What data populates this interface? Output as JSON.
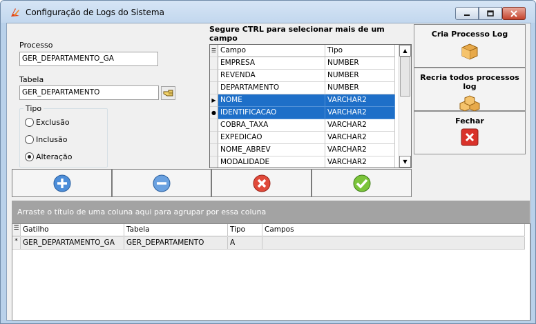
{
  "window": {
    "title": "Configuração de Logs do Sistema",
    "accent": "#1e6fc8"
  },
  "form": {
    "processo_label": "Processo",
    "processo_value": "GER_DEPARTAMENTO_GA",
    "tabela_label": "Tabela",
    "tabela_value": "GER_DEPARTAMENTO",
    "tipo_label": "Tipo",
    "tipo_options": [
      "Exclusão",
      "Inclusão",
      "Alteração"
    ],
    "tipo_selected": "Alteração"
  },
  "fields_grid": {
    "hint": "Segure CTRL para selecionar mais de um campo",
    "columns": [
      "Campo",
      "Tipo"
    ],
    "rows": [
      {
        "campo": "EMPRESA",
        "tipo": "NUMBER",
        "selected": false
      },
      {
        "campo": "REVENDA",
        "tipo": "NUMBER",
        "selected": false
      },
      {
        "campo": "DEPARTAMENTO",
        "tipo": "NUMBER",
        "selected": false
      },
      {
        "campo": "NOME",
        "tipo": "VARCHAR2",
        "selected": true
      },
      {
        "campo": "IDENTIFICACAO",
        "tipo": "VARCHAR2",
        "selected": true
      },
      {
        "campo": "COBRA_TAXA",
        "tipo": "VARCHAR2",
        "selected": false
      },
      {
        "campo": "EXPEDICAO",
        "tipo": "VARCHAR2",
        "selected": false
      },
      {
        "campo": "NOME_ABREV",
        "tipo": "VARCHAR2",
        "selected": false
      },
      {
        "campo": "MODALIDADE",
        "tipo": "VARCHAR2",
        "selected": false
      }
    ]
  },
  "side_buttons": {
    "cria": "Cria Processo Log",
    "recria": "Recria todos processos log",
    "fechar": "Fechar"
  },
  "toolbar_icons": [
    "add-icon",
    "remove-icon",
    "cancel-icon",
    "confirm-icon"
  ],
  "bottom_grid": {
    "group_hint": "Arraste o título de uma coluna aqui para agrupar por essa coluna",
    "columns": [
      "Gatilho",
      "Tabela",
      "Tipo",
      "Campos"
    ],
    "rows": [
      {
        "indicator": "*",
        "gatilho": "GER_DEPARTAMENTO_GA",
        "tabela": "GER_DEPARTAMENTO",
        "tipo": "A",
        "campos": ""
      }
    ]
  }
}
